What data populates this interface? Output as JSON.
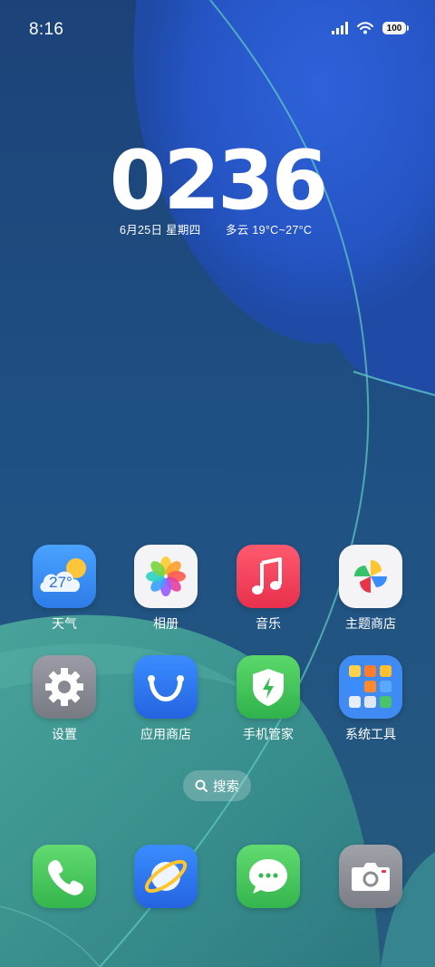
{
  "status_bar": {
    "time": "8:16",
    "battery_level": "100",
    "icons": [
      "signal-icon",
      "wifi-icon",
      "battery-icon"
    ]
  },
  "clock": {
    "time": "0236",
    "date": "6月25日 星期四",
    "weather": "多云 19°C~27°C"
  },
  "apps": [
    {
      "label": "天气",
      "icon": "weather-icon",
      "badge_text": "27°"
    },
    {
      "label": "相册",
      "icon": "photos-icon"
    },
    {
      "label": "音乐",
      "icon": "music-icon"
    },
    {
      "label": "主题商店",
      "icon": "theme-store-icon"
    },
    {
      "label": "设置",
      "icon": "settings-icon"
    },
    {
      "label": "应用商店",
      "icon": "app-store-icon"
    },
    {
      "label": "手机管家",
      "icon": "phone-manager-icon"
    },
    {
      "label": "系统工具",
      "icon": "system-tools-folder-icon"
    }
  ],
  "search": {
    "label": "搜索",
    "icon": "search-icon"
  },
  "dock": [
    {
      "icon": "phone-icon"
    },
    {
      "icon": "browser-icon"
    },
    {
      "icon": "messages-icon"
    },
    {
      "icon": "camera-icon"
    }
  ],
  "colors": {
    "wallpaper_base": "#1f4f86",
    "wallpaper_blue": "#2a5ed8",
    "wallpaper_teal": "#3d9a93",
    "accent_line": "#5cc8c0"
  }
}
